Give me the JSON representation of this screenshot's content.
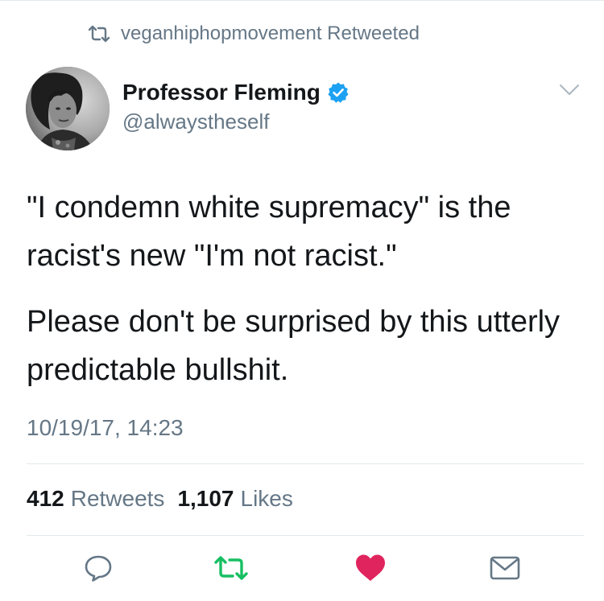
{
  "retweet_banner": {
    "text": "veganhiphopmovement Retweeted",
    "icon": "retweet-icon"
  },
  "author": {
    "display_name": "Professor Fleming",
    "handle": "@alwaystheself",
    "verified": true,
    "verified_icon": "verified-badge-icon"
  },
  "tweet": {
    "paragraphs": [
      "\"I condemn white supremacy\" is the racist's new \"I'm not racist.\"",
      "Please don't be surprised by this utterly predictable bullshit."
    ],
    "timestamp": "10/19/17, 14:23"
  },
  "stats": {
    "retweets_count": "412",
    "retweets_label": "Retweets",
    "likes_count": "1,107",
    "likes_label": "Likes"
  },
  "actions": {
    "reply_icon": "reply-icon",
    "retweet_icon": "retweet-icon",
    "like_icon": "heart-icon",
    "dm_icon": "mail-icon"
  },
  "colors": {
    "text": "#14171a",
    "secondary": "#657786",
    "retweet_green": "#17bf63",
    "like_red": "#e0245e",
    "verified_blue": "#1da1f2",
    "divider": "#e1e8ed"
  }
}
